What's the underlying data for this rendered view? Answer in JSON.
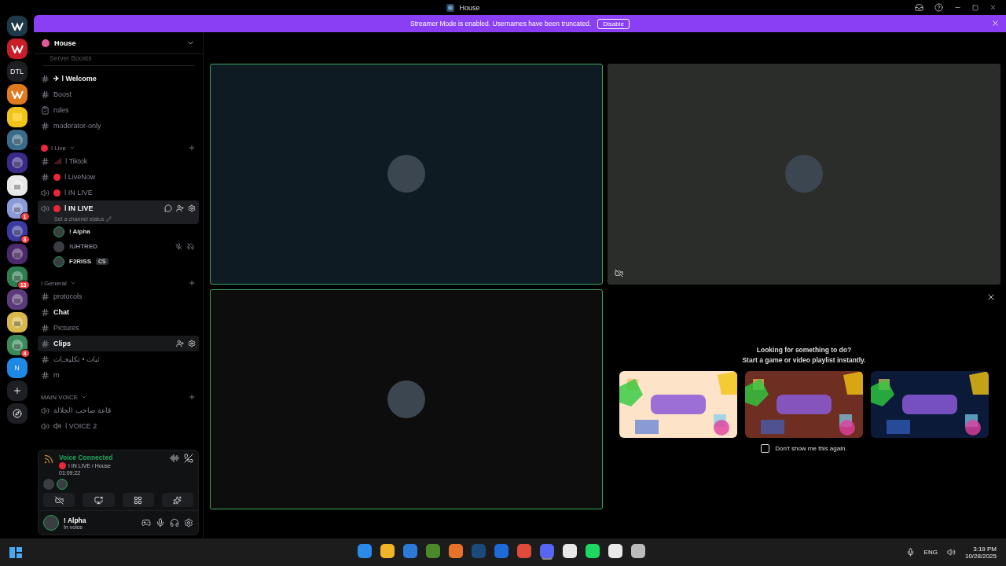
{
  "window": {
    "title": "House"
  },
  "banner": {
    "text": "Streamer Mode is enabled. Usernames have been truncated.",
    "button": "Disable"
  },
  "servers": [
    {
      "kind": "logo",
      "color": "#1e3a4a"
    },
    {
      "kind": "logo",
      "color": "#c81e2a"
    },
    {
      "kind": "text",
      "label": "DTL",
      "color": "#1e1f22"
    },
    {
      "kind": "logo",
      "color": "#e07a1f"
    },
    {
      "kind": "folder",
      "color": "#f0c419"
    },
    {
      "kind": "picture",
      "color": "#3a6c8a"
    },
    {
      "kind": "picture",
      "color": "#3b2a8a"
    },
    {
      "kind": "picture",
      "color": "#e8e8e8"
    },
    {
      "kind": "picture",
      "color": "#8a9ad8",
      "badge": "1"
    },
    {
      "kind": "picture",
      "color": "#3a3aa0",
      "badge": "3"
    },
    {
      "kind": "picture",
      "color": "#4a2a6a"
    },
    {
      "kind": "picture",
      "color": "#2e7d4f",
      "badge": "13"
    },
    {
      "kind": "picture",
      "color": "#5a3a7a"
    },
    {
      "kind": "picture",
      "color": "#d8b84a"
    },
    {
      "kind": "picture",
      "color": "#3a8a5a",
      "badge": "4"
    },
    {
      "kind": "text",
      "label": "N",
      "color": "#1e88e5"
    },
    {
      "kind": "add",
      "color": "#1e1f22"
    },
    {
      "kind": "discover",
      "color": "#1e1f22"
    }
  ],
  "sidebar": {
    "server_name": "House",
    "cut_item": "Server Boosts",
    "items": [
      {
        "kind": "text",
        "name": "✈ ǀ Welcome",
        "unread": true,
        "selected": false,
        "hovered": false
      },
      {
        "kind": "text",
        "name": "Boost",
        "unread": false,
        "selected": false,
        "hovered": false
      },
      {
        "kind": "rules",
        "name": "rules",
        "unread": false,
        "selected": false,
        "hovered": false
      },
      {
        "kind": "locked",
        "name": "moderator-only",
        "unread": false,
        "selected": false,
        "hovered": false
      },
      {
        "kind": "category",
        "name": "ǀ Live",
        "dot": true
      },
      {
        "kind": "text",
        "signal": true,
        "name": "ǀ Tiktok",
        "unread": false,
        "selected": false,
        "hovered": false
      },
      {
        "kind": "text",
        "live": true,
        "name": "ǀ LiveNow",
        "unread": false,
        "selected": false,
        "hovered": false
      },
      {
        "kind": "voice",
        "live": true,
        "name": "ǀ IN LIVE",
        "unread": false,
        "selected": false,
        "hovered": false
      },
      {
        "kind": "voice",
        "live": true,
        "name": "ǀ IN LIVE",
        "unread": true,
        "selected": true,
        "hovered": false,
        "status": "Set a channel status",
        "users": [
          {
            "name": "! Alpha",
            "muted": false,
            "speaking": true
          },
          {
            "name": "!UHTRED",
            "muted": true,
            "speaking": false
          },
          {
            "name": "F2RISS",
            "tag": "CS",
            "muted": false,
            "speaking": true
          }
        ]
      },
      {
        "kind": "category",
        "name": "ǀ General",
        "dot": false
      },
      {
        "kind": "text",
        "name": "protocols",
        "unread": false,
        "selected": false,
        "hovered": false
      },
      {
        "kind": "text",
        "name": "Chat",
        "unread": true,
        "selected": false,
        "hovered": false
      },
      {
        "kind": "text",
        "name": "Pictures",
        "unread": false,
        "selected": false,
        "hovered": false
      },
      {
        "kind": "text",
        "name": "Clips",
        "unread": true,
        "selected": false,
        "hovered": true
      },
      {
        "kind": "text",
        "name": "ثبات • تكليجـات",
        "unread": false,
        "selected": false,
        "hovered": false
      },
      {
        "kind": "text",
        "name": "m",
        "unread": false,
        "selected": false,
        "hovered": false
      },
      {
        "kind": "category",
        "name": "MAIN VOICE",
        "dot": false
      },
      {
        "kind": "voice",
        "name": "قاعة صاحب الجلالة",
        "unread": false,
        "selected": false,
        "hovered": false
      },
      {
        "kind": "voice",
        "speaker": true,
        "name": "ǀ VOICE 2",
        "unread": false,
        "selected": false,
        "hovered": false
      }
    ]
  },
  "voice_panel": {
    "status": "Voice Connected",
    "channel": "ǀ IN LIVE / House",
    "elapsed": "01:09:22"
  },
  "user": {
    "name": "! Alpha",
    "status": "In voice"
  },
  "tiles": [
    {
      "speaking": true,
      "color": "#0f1b22",
      "video_off": false
    },
    {
      "speaking": false,
      "color": "#2b2d2b",
      "video_off": true
    },
    {
      "speaking": true,
      "color": "#0d0d0d",
      "video_off": false
    }
  ],
  "activities": {
    "title": "Looking for something to do?",
    "subtitle": "Start a game or video playlist instantly.",
    "cards": [
      {
        "kind": "picture",
        "color": "#fde3c8"
      },
      {
        "kind": "picture",
        "color": "#6e2e22"
      },
      {
        "kind": "picture",
        "color": "#0c1a3a"
      }
    ],
    "checkbox": {
      "label": "Don't show me this again.",
      "checked": false
    }
  },
  "taskbar": {
    "apps": [
      {
        "color": "#2a8ae8",
        "active": false
      },
      {
        "color": "#f0b429",
        "active": false
      },
      {
        "color": "#2b7ad8",
        "active": false
      },
      {
        "color": "#4a8a2a",
        "active": false
      },
      {
        "color": "#e8722a",
        "active": false
      },
      {
        "color": "#1b4a7a",
        "active": false
      },
      {
        "color": "#1e6ad8",
        "active": false
      },
      {
        "color": "#e04a3a",
        "active": false
      },
      {
        "color": "#5865f2",
        "active": true
      },
      {
        "color": "#e8e8e8",
        "active": false
      },
      {
        "color": "#1ed760",
        "active": false
      },
      {
        "color": "#e8e8e8",
        "active": false
      },
      {
        "color": "#bbbbbb",
        "active": false
      }
    ],
    "language": "ENG",
    "time": "3:19 PM",
    "date": "10/28/2025"
  }
}
